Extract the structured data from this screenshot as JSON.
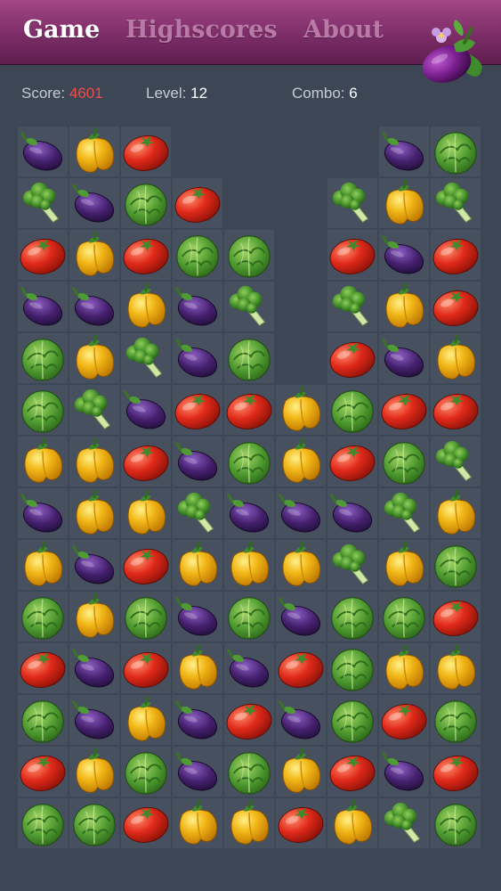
{
  "nav": {
    "game": "Game",
    "highscores": "Highscores",
    "about": "About",
    "active": "game"
  },
  "logo_icon": "eggplant-logo-icon",
  "status": {
    "score_label": "Score:",
    "score": "4601",
    "level_label": "Level:",
    "level": "12",
    "combo_label": "Combo:",
    "combo": "6"
  },
  "colors": {
    "background": "#3c4655",
    "header": "#7c2d67",
    "score_value": "#f04a4a"
  },
  "board": {
    "columns": 9,
    "rows": 14,
    "legend": {
      "E": "eggplant",
      "P": "yellow-pepper",
      "T": "tomato",
      "C": "cabbage",
      "B": "broccoli",
      ".": "empty"
    },
    "grid": [
      "EPT....EC",
      "BECT..BPB",
      "TPTCC.TET",
      "EEPEB.BPT",
      "CPBEC.TEP",
      "CBETTPCTT",
      "PPTECPTCB",
      "EPPBEEEBP",
      "PETPPPBPC",
      "CPCECECCT",
      "TETPETCPP",
      "CEPETECTC",
      "TPCECPTET",
      "CCTPPTPBC"
    ]
  }
}
